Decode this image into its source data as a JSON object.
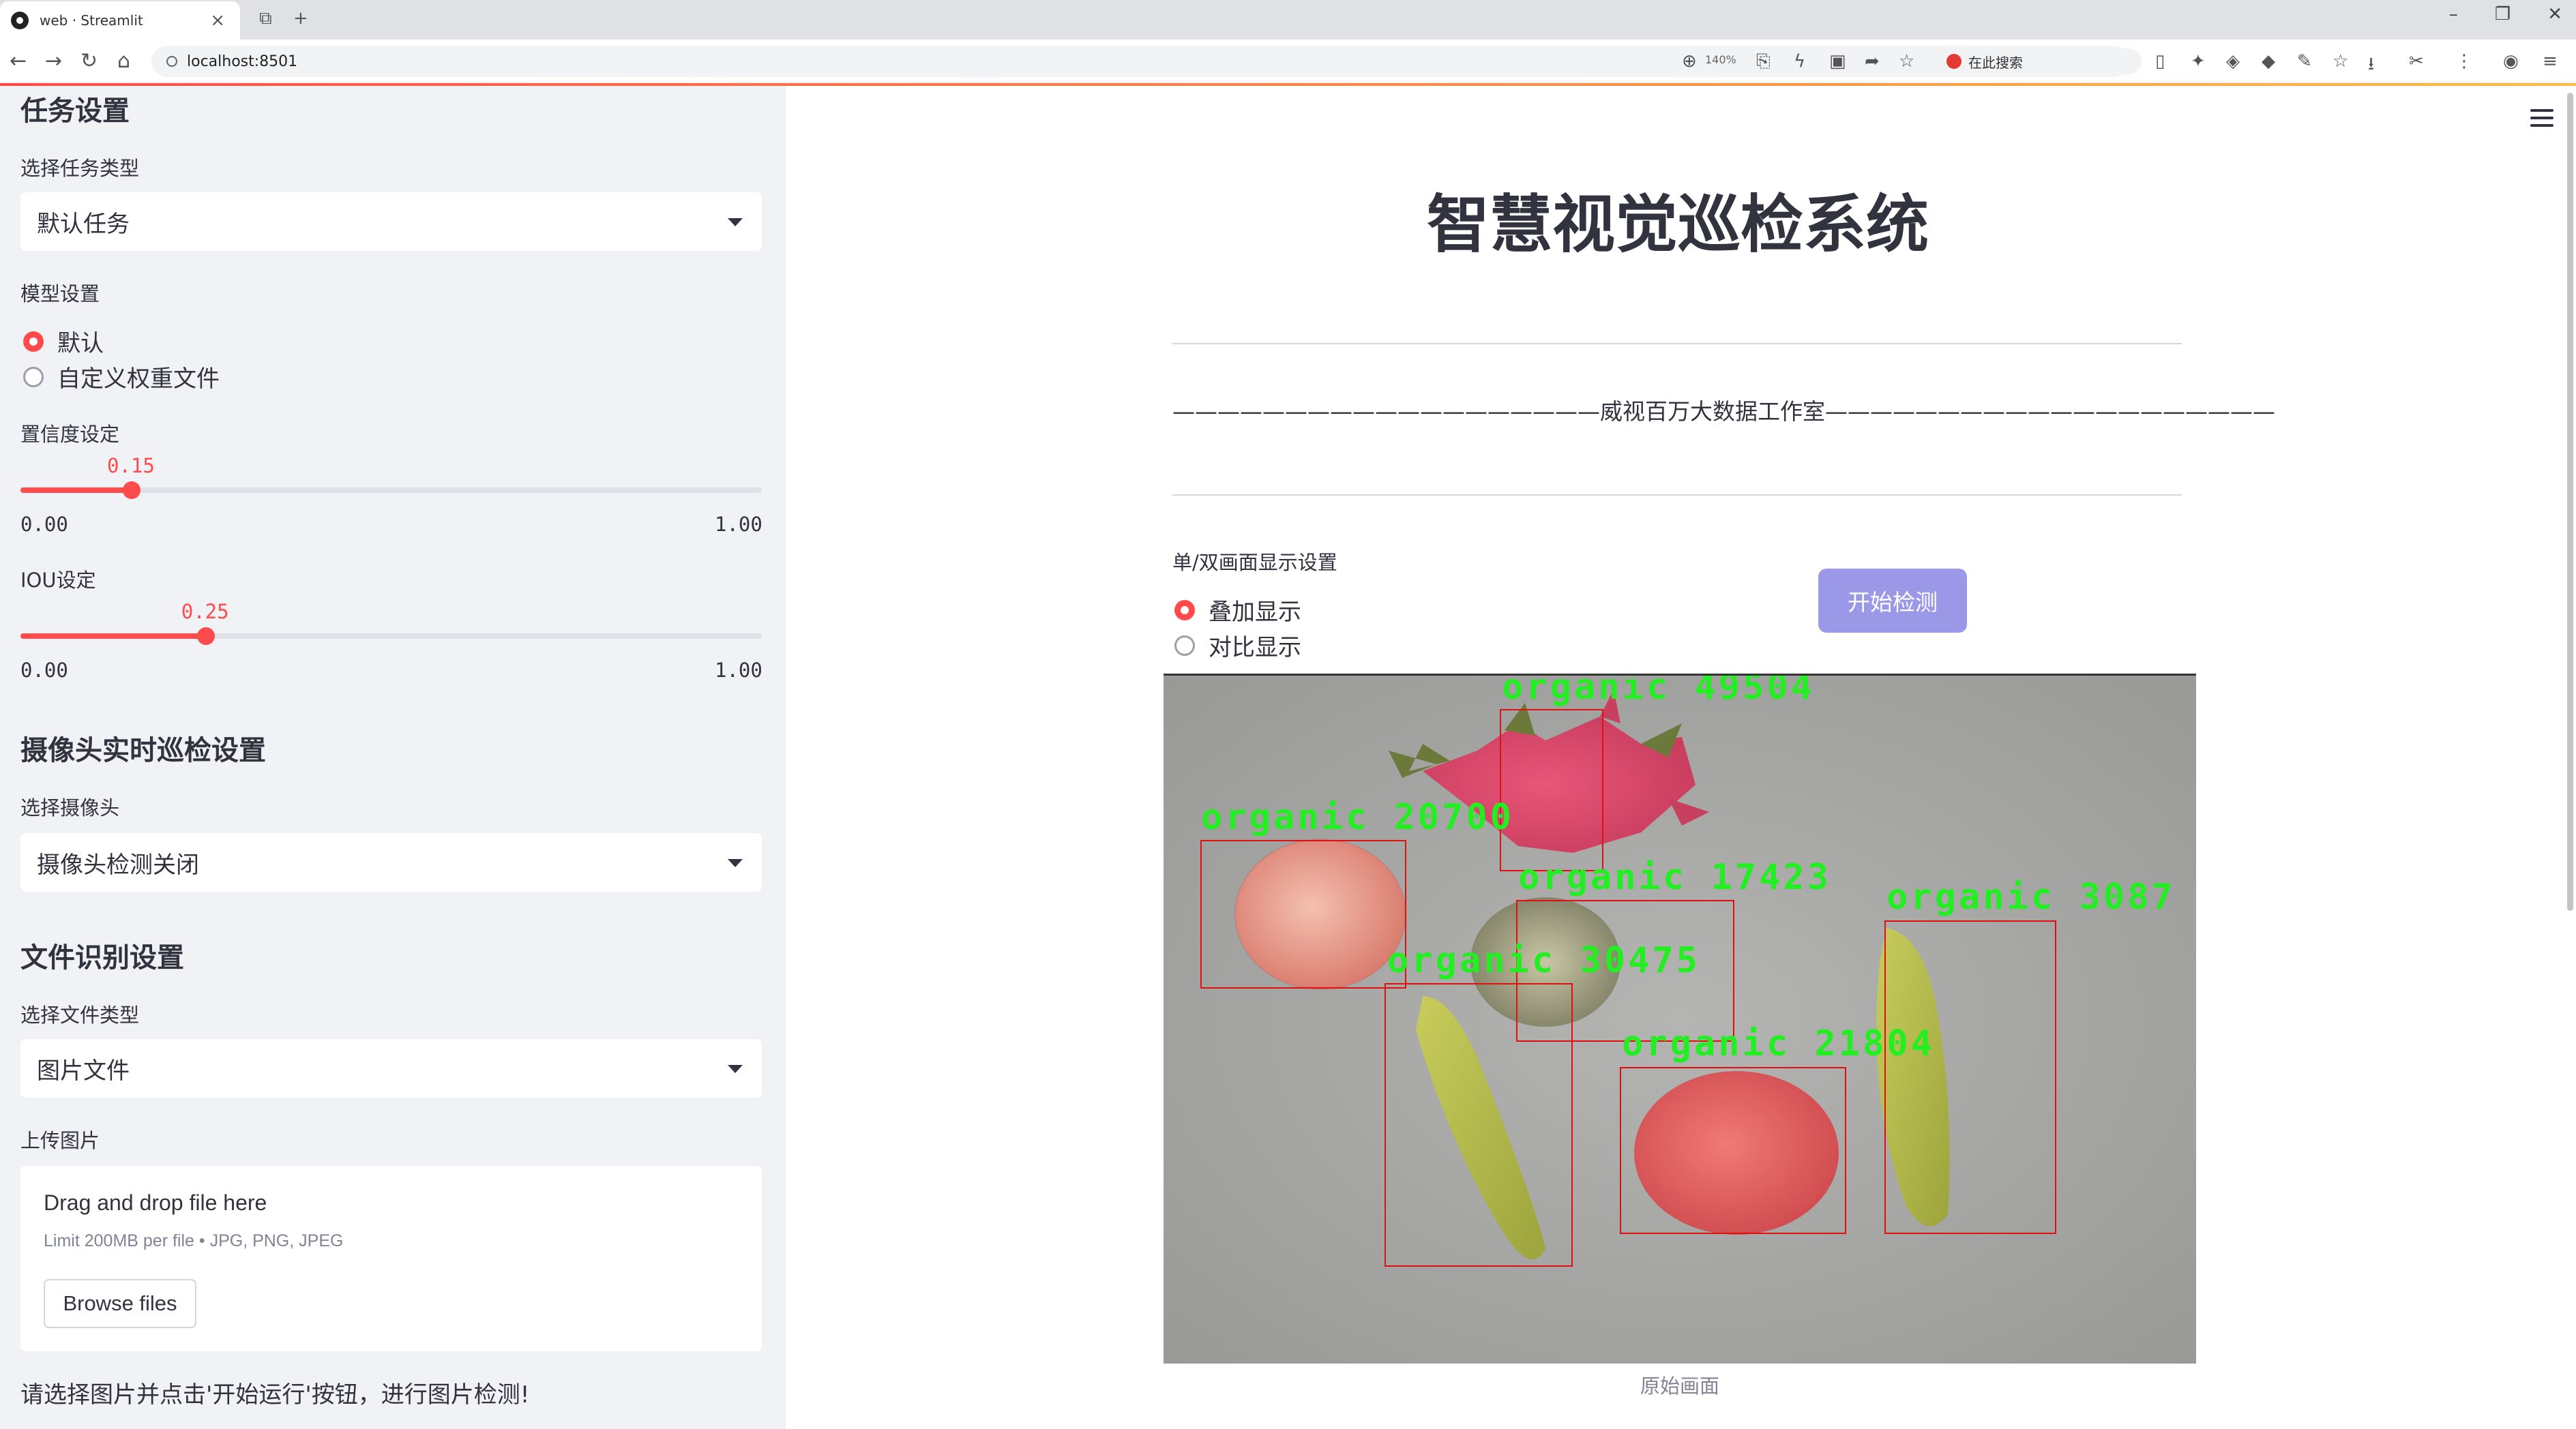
{
  "browser": {
    "tab_title": "web · Streamlit",
    "url": "localhost:8501",
    "zoom": "140%",
    "search_label": "在此搜索"
  },
  "sidebar": {
    "task_header": "任务设置",
    "task_type_label": "选择任务类型",
    "task_type_value": "默认任务",
    "model_label": "模型设置",
    "model_options": [
      "默认",
      "自定义权重文件"
    ],
    "model_selected": "默认",
    "conf_label": "置信度设定",
    "conf": {
      "value": 0.15,
      "display": "0.15",
      "min": "0.00",
      "max": "1.00"
    },
    "iou_label": "IOU设定",
    "iou": {
      "value": 0.25,
      "display": "0.25",
      "min": "0.00",
      "max": "1.00"
    },
    "camera_header": "摄像头实时巡检设置",
    "camera_label": "选择摄像头",
    "camera_value": "摄像头检测关闭",
    "file_header": "文件识别设置",
    "file_type_label": "选择文件类型",
    "file_type_value": "图片文件",
    "upload_label": "上传图片",
    "dropzone_title": "Drag and drop file here",
    "dropzone_limit": "Limit 200MB per file • JPG, PNG, JPEG",
    "browse_label": "Browse files",
    "hint": "请选择图片并点击'开始运行'按钮，进行图片检测!"
  },
  "main": {
    "title": "智慧视觉巡检系统",
    "banner": "———————————————————威视百万大数据工作室————————————————————",
    "display_label": "单/双画面显示设置",
    "display_options": [
      "叠加显示",
      "对比显示"
    ],
    "display_selected": "叠加显示",
    "start_button": "开始检测",
    "caption": "原始画面",
    "colors": {
      "accent": "#ff4b4b",
      "button": "#9c98e8",
      "box": "#e01010",
      "label": "#22ee22"
    },
    "detections": [
      {
        "label": "organic",
        "id": "49504",
        "object": "dragon fruit"
      },
      {
        "label": "organic",
        "id": "20700",
        "object": "apple"
      },
      {
        "label": "organic",
        "id": "17423",
        "object": "melon"
      },
      {
        "label": "organic",
        "id": "30475",
        "object": "banana"
      },
      {
        "label": "organic",
        "id": "21804",
        "object": "apple"
      },
      {
        "label": "organic",
        "id": "3087",
        "object": "banana"
      }
    ]
  }
}
